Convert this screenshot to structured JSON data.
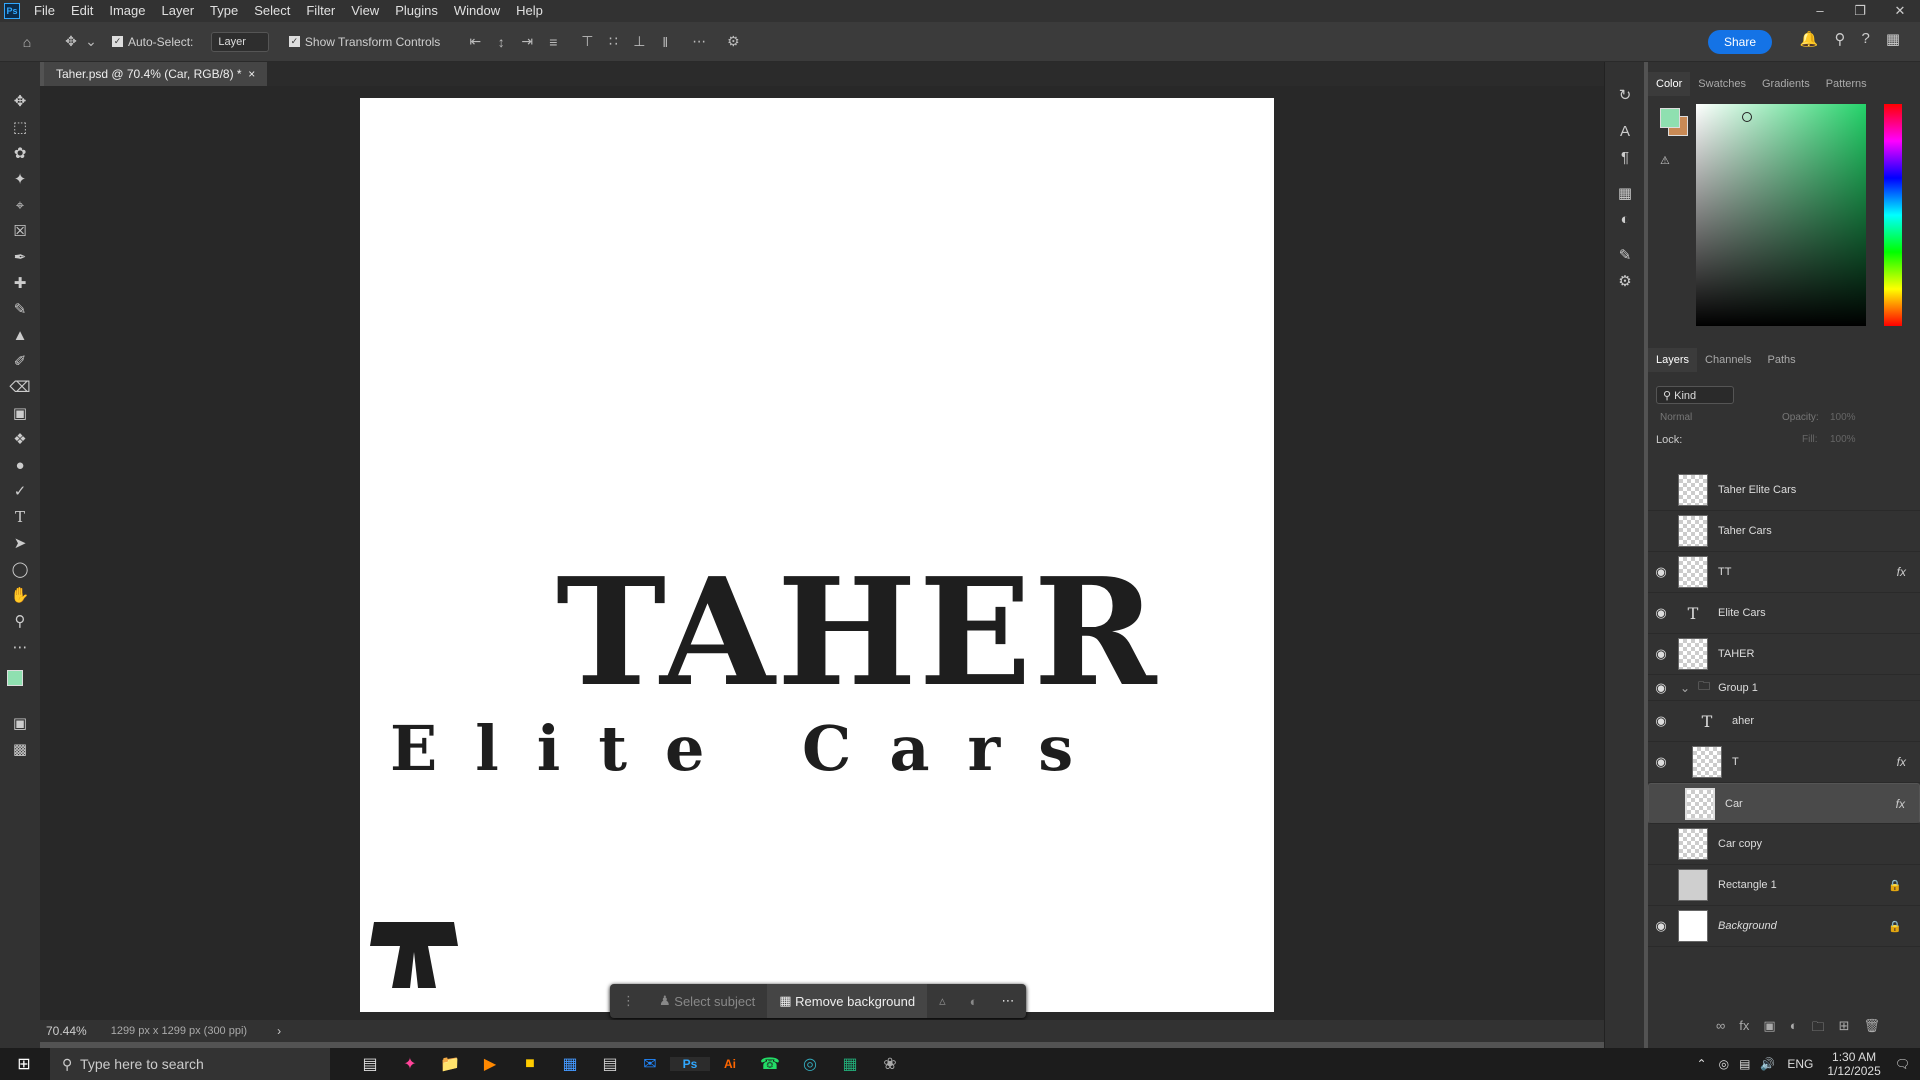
{
  "menu": [
    "File",
    "Edit",
    "Image",
    "Layer",
    "Type",
    "Select",
    "Filter",
    "View",
    "Plugins",
    "Window",
    "Help"
  ],
  "app_logo": "Ps",
  "options": {
    "auto_select_label": "Auto-Select:",
    "auto_select_value": "Layer",
    "transform_label": "Show Transform Controls",
    "share": "Share"
  },
  "doc_tab": "Taher.psd @ 70.4% (Car, RGB/8) *",
  "canvas": {
    "title": "TAHER",
    "subtitle": "Elite Cars"
  },
  "context_bar": {
    "select_subject": "Select subject",
    "remove_bg": "Remove background"
  },
  "status": {
    "zoom": "70.44%",
    "dims": "1299 px x 1299 px (300 ppi)"
  },
  "panels": {
    "color_tabs": [
      "Color",
      "Swatches",
      "Gradients",
      "Patterns"
    ],
    "layer_tabs": [
      "Layers",
      "Channels",
      "Paths"
    ],
    "kind": "Kind",
    "blend": "Normal",
    "opacity_label": "Opacity:",
    "opacity": "100%",
    "lock_label": "Lock:",
    "fill_label": "Fill:",
    "fill": "100%"
  },
  "layers": [
    {
      "name": "Taher Elite Cars",
      "visible": false
    },
    {
      "name": "Taher Cars",
      "visible": false
    },
    {
      "name": "TT",
      "visible": true,
      "fx": true
    },
    {
      "name": "Elite Cars",
      "visible": true,
      "type": "text"
    },
    {
      "name": "TAHER",
      "visible": true
    },
    {
      "name": "Group 1",
      "visible": true,
      "group": true
    },
    {
      "name": "aher",
      "visible": true,
      "type": "text"
    },
    {
      "name": "T",
      "visible": true,
      "fx": true
    },
    {
      "name": "Car",
      "visible": false,
      "fx": true,
      "selected": true
    },
    {
      "name": "Car copy",
      "visible": false
    },
    {
      "name": "Rectangle 1",
      "visible": false,
      "locked": true
    },
    {
      "name": "Background",
      "visible": true,
      "locked": true
    }
  ],
  "taskbar": {
    "search": "Type here to search",
    "lang": "ENG",
    "time": "1:30 AM",
    "date": "1/12/2025"
  },
  "colors": {
    "foreground": "#8fe0b0",
    "background": "#c98a55",
    "accent": "#1473e6"
  }
}
